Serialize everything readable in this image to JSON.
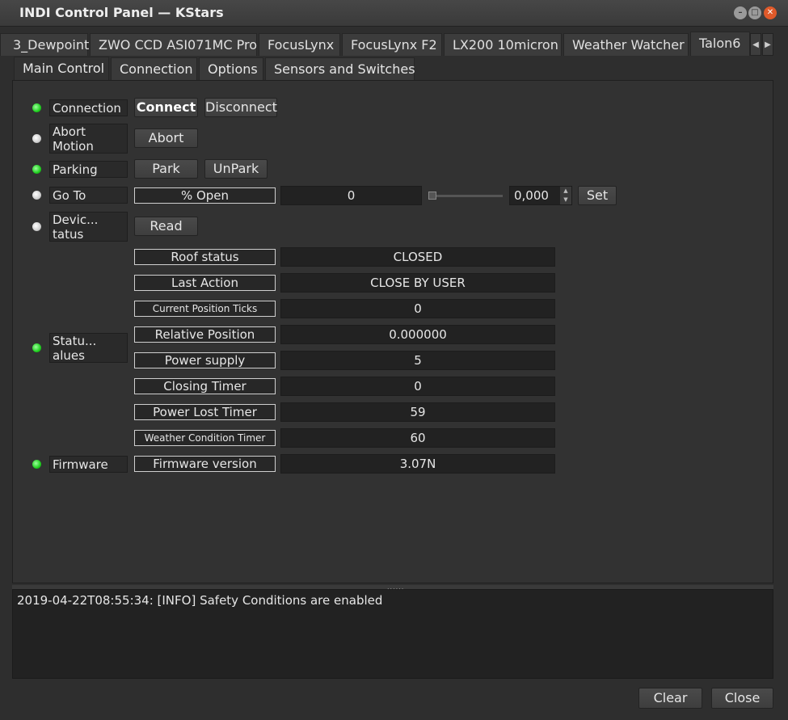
{
  "window": {
    "title": "INDI Control Panel — KStars"
  },
  "device_tabs": [
    "3_Dewpoint",
    "ZWO CCD ASI071MC Pro",
    "FocusLynx",
    "FocusLynx F2",
    "LX200 10micron",
    "Weather Watcher",
    "Talon6"
  ],
  "sub_tabs": [
    "Main Control",
    "Connection",
    "Options",
    "Sensors and Switches"
  ],
  "properties": {
    "connection": {
      "label": "Connection",
      "connect": "Connect",
      "disconnect": "Disconnect",
      "state": "ok"
    },
    "abort": {
      "label": "Abort Motion",
      "button": "Abort",
      "state": "idle"
    },
    "parking": {
      "label": "Parking",
      "park": "Park",
      "unpark": "UnPark",
      "state": "ok"
    },
    "goto": {
      "label": "Go To",
      "element": "% Open",
      "current": "0",
      "spin_value": "0,000",
      "set": "Set",
      "state": "idle"
    },
    "device_status": {
      "label": "Devic... tatus",
      "button": "Read",
      "state": "idle"
    },
    "status_values": {
      "label": "Statu... alues",
      "state": "ok",
      "rows": [
        {
          "name": "Roof status",
          "value": "CLOSED"
        },
        {
          "name": "Last Action",
          "value": "CLOSE BY USER"
        },
        {
          "name": "Current Position Ticks",
          "value": "0"
        },
        {
          "name": "Relative Position",
          "value": "0.000000"
        },
        {
          "name": "Power supply",
          "value": "5"
        },
        {
          "name": "Closing Timer",
          "value": "0"
        },
        {
          "name": "Power Lost Timer",
          "value": "59"
        },
        {
          "name": "Weather Condition Timer",
          "value": "60"
        }
      ]
    },
    "firmware": {
      "label": "Firmware",
      "element": "Firmware version",
      "value": "3.07N",
      "state": "ok"
    }
  },
  "log": {
    "lines": [
      "2019-04-22T08:55:34: [INFO] Safety Conditions are enabled"
    ]
  },
  "footer": {
    "clear": "Clear",
    "close": "Close"
  },
  "colors": {
    "ok_led": "#1fcf1f",
    "idle_led": "#cfcfcf",
    "background": "#2e2e2e"
  }
}
